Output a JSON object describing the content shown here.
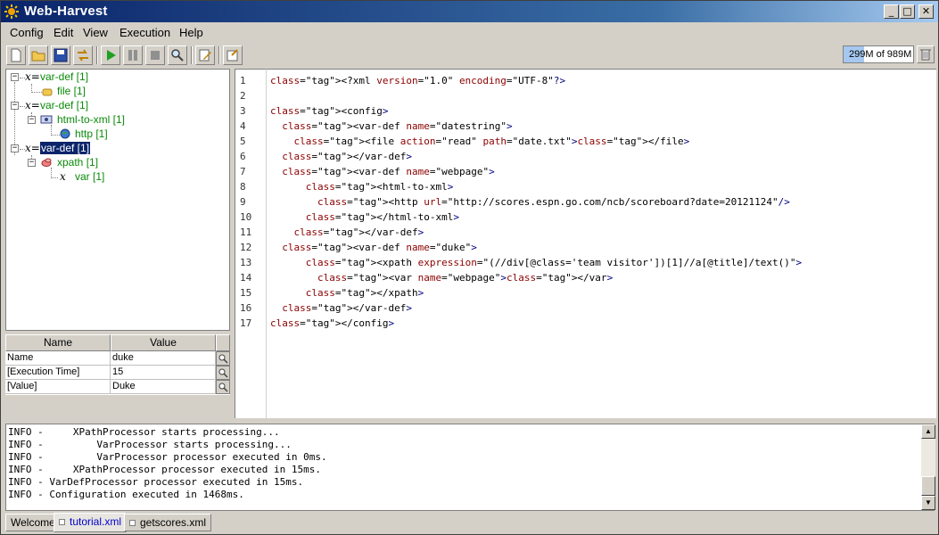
{
  "window": {
    "title": "Web-Harvest",
    "minimize": "_",
    "maximize": "□",
    "close": "✕"
  },
  "menu": {
    "items": [
      "Config",
      "Edit",
      "View",
      "Execution",
      "Help"
    ]
  },
  "toolbar": {
    "memory": "299M of 989M",
    "memory_used_fraction": 0.3,
    "icons": [
      "new-file-icon",
      "open-folder-icon",
      "save-icon",
      "refresh-icon",
      "run-icon",
      "pause-icon",
      "stop-icon",
      "search-icon",
      "edit-icon",
      "settings-icon",
      "trash-icon"
    ]
  },
  "tree": {
    "nodes": [
      {
        "label": "var-def [1]",
        "icon": "x-var-icon"
      },
      {
        "label": "file [1]",
        "icon": "file-icon"
      },
      {
        "label": "var-def [1]",
        "icon": "x-var-icon"
      },
      {
        "label": "html-to-xml [1]",
        "icon": "html-icon"
      },
      {
        "label": "http [1]",
        "icon": "globe-icon"
      },
      {
        "label": "var-def [1]",
        "icon": "x-var-icon",
        "selected": true
      },
      {
        "label": "xpath [1]",
        "icon": "xpath-icon"
      },
      {
        "label": "var [1]",
        "icon": "x-icon"
      }
    ]
  },
  "properties": {
    "headers": [
      "Name",
      "Value"
    ],
    "rows": [
      {
        "name": "Name",
        "value": "duke"
      },
      {
        "name": "[Execution Time]",
        "value": "15"
      },
      {
        "name": "[Value]",
        "value": "Duke"
      }
    ]
  },
  "editor": {
    "line_numbers": [
      "1",
      "2",
      "3",
      "4",
      "5",
      "6",
      "7",
      "8",
      "9",
      "10",
      "11",
      "12",
      "13",
      "14",
      "15",
      "16",
      "17"
    ],
    "lines": [
      "<?xml version=\"1.0\" encoding=\"UTF-8\"?>",
      "",
      "<config>",
      "  <var-def name=\"datestring\">",
      "    <file action=\"read\" path=\"date.txt\"></file>",
      "  </var-def>",
      "  <var-def name=\"webpage\">",
      "      <html-to-xml>",
      "        <http url=\"http://scores.espn.go.com/ncb/scoreboard?date=20121124\"/>",
      "      </html-to-xml>",
      "    </var-def>",
      "  <var-def name=\"duke\">",
      "      <xpath expression=\"(//div[@class='team visitor'])[1]//a[@title]/text()\">",
      "        <var name=\"webpage\"></var>",
      "      </xpath>",
      "  </var-def>",
      "</config>"
    ]
  },
  "log": {
    "lines": [
      "INFO -     XPathProcessor starts processing...",
      "INFO -         VarProcessor starts processing...",
      "INFO -         VarProcessor processor executed in 0ms.",
      "INFO -     XPathProcessor processor executed in 15ms.",
      "INFO - VarDefProcessor processor executed in 15ms.",
      "INFO - Configuration executed in 1468ms."
    ]
  },
  "tabs": [
    {
      "label": "Welcome",
      "active": false
    },
    {
      "label": "tutorial.xml",
      "active": true
    },
    {
      "label": "getscores.xml",
      "active": false
    }
  ]
}
